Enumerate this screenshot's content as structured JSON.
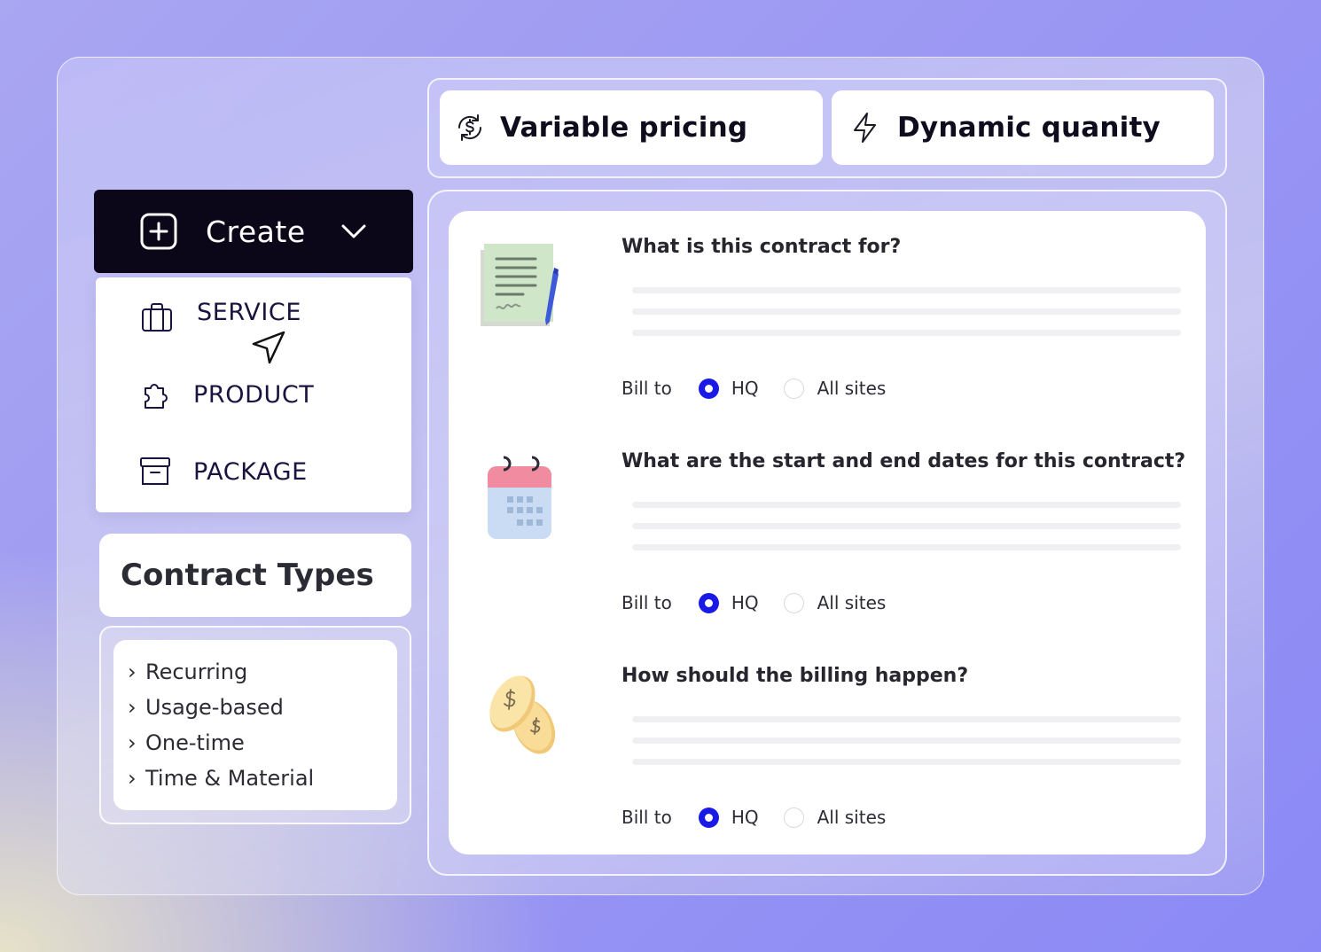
{
  "top_pills": [
    {
      "label": "Variable pricing",
      "icon": "dollar-refresh-icon"
    },
    {
      "label": "Dynamic quanity",
      "icon": "lightning-icon"
    }
  ],
  "create_menu": {
    "button_label": "Create",
    "items": [
      {
        "label": "SERVICE",
        "icon": "briefcase-icon"
      },
      {
        "label": "PRODUCT",
        "icon": "puzzle-icon"
      },
      {
        "label": "PACKAGE",
        "icon": "archive-box-icon"
      }
    ]
  },
  "contract_types": {
    "title": "Contract Types",
    "items": [
      "Recurring",
      "Usage-based",
      "One-time",
      "Time & Material"
    ]
  },
  "questions": [
    {
      "text": "What is this contract for?",
      "illustration": "contract-document-icon",
      "bill_label": "Bill to",
      "options": [
        "HQ",
        "All sites"
      ],
      "selected": "HQ"
    },
    {
      "text": "What are the start and end dates for this contract?",
      "illustration": "calendar-icon",
      "bill_label": "Bill to",
      "options": [
        "HQ",
        "All sites"
      ],
      "selected": "HQ"
    },
    {
      "text": "How should the billing happen?",
      "illustration": "coins-icon",
      "bill_label": "Bill to",
      "options": [
        "HQ",
        "All sites"
      ],
      "selected": "HQ"
    }
  ],
  "colors": {
    "accent": "#1a1ae6",
    "create_bg": "#0c0718",
    "background": "#9b98f3"
  }
}
